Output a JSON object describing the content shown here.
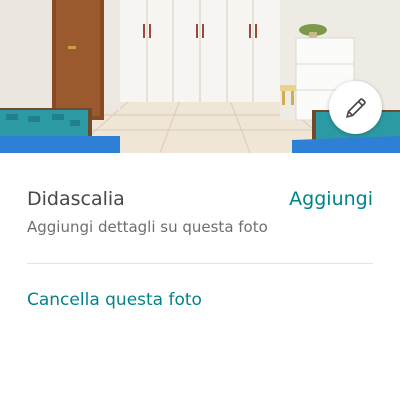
{
  "photo": {
    "description_icon": "bedroom-photo"
  },
  "edit_button": {
    "icon": "pencil-icon"
  },
  "caption": {
    "title": "Didascalia",
    "add_label": "Aggiungi",
    "hint": "Aggiungi dettagli su questa foto"
  },
  "actions": {
    "delete_label": "Cancella questa foto"
  },
  "colors": {
    "accent": "#008489",
    "text_primary": "#484848",
    "text_secondary": "#6f6f6f"
  }
}
